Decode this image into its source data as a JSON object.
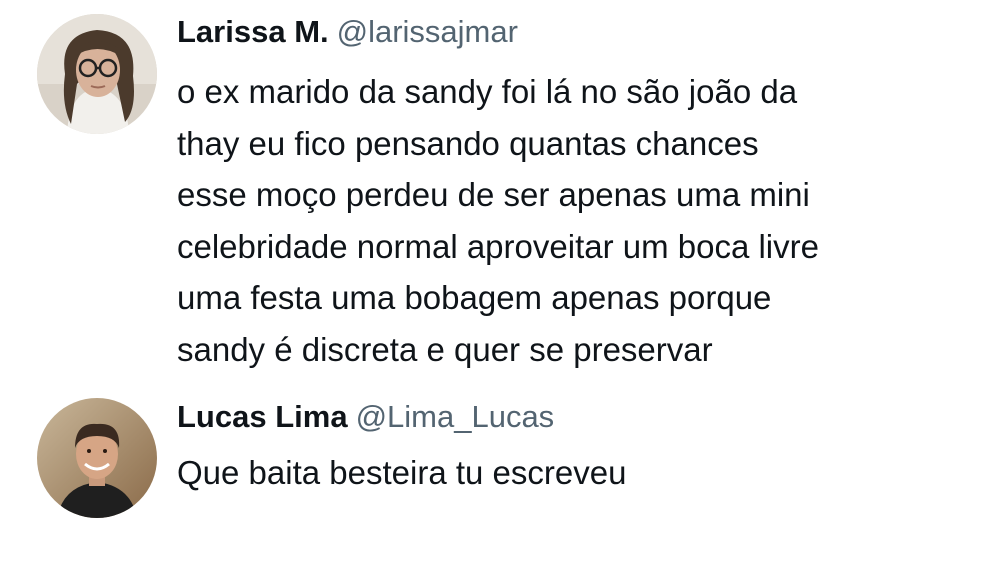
{
  "tweets": [
    {
      "author": {
        "name": "Larissa M.",
        "handle": "@larissajmar",
        "avatar_icon": "person-glasses-avatar"
      },
      "text_lines": [
        "o ex marido da sandy foi lá no são joão da",
        "thay eu fico pensando quantas chances",
        "esse moço perdeu de ser apenas uma mini",
        "celebridade normal aproveitar um boca livre",
        "uma festa uma bobagem apenas porque",
        "sandy é discreta e quer se preservar"
      ]
    },
    {
      "author": {
        "name": "Lucas Lima",
        "handle": "@Lima_Lucas",
        "avatar_icon": "person-smiling-avatar"
      },
      "text_lines": [
        "Que baita besteira tu escreveu"
      ]
    }
  ]
}
